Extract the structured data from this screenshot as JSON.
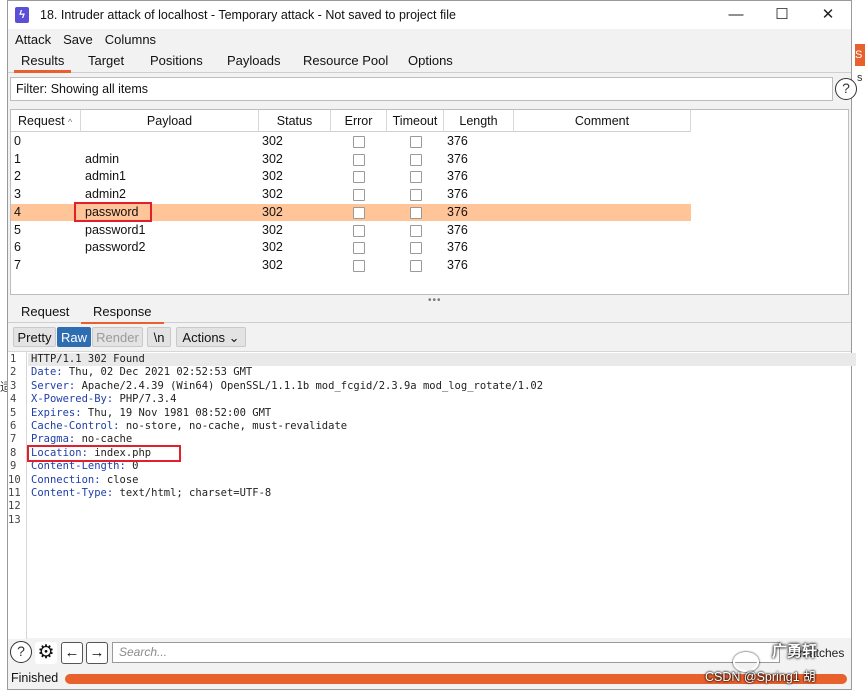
{
  "window": {
    "title": "18. Intruder attack of localhost - Temporary attack - Not saved to project file",
    "app_icon": "burp-bolt-icon",
    "controls": {
      "minimize": "—",
      "maximize": "☐",
      "close": "✕"
    }
  },
  "menu": {
    "items": [
      "Attack",
      "Save",
      "Columns"
    ]
  },
  "tabs": [
    "Results",
    "Target",
    "Positions",
    "Payloads",
    "Resource Pool",
    "Options"
  ],
  "active_tab": "Results",
  "filter": {
    "text": "Filter: Showing all items",
    "help": "?"
  },
  "table": {
    "columns": [
      "Request",
      "Payload",
      "Status",
      "Error",
      "Timeout",
      "Length",
      "Comment"
    ],
    "sort_indicator": "^",
    "rows": [
      {
        "request": "0",
        "payload": "",
        "status": "302",
        "length": "376"
      },
      {
        "request": "1",
        "payload": "admin",
        "status": "302",
        "length": "376"
      },
      {
        "request": "2",
        "payload": "admin1",
        "status": "302",
        "length": "376"
      },
      {
        "request": "3",
        "payload": "admin2",
        "status": "302",
        "length": "376"
      },
      {
        "request": "4",
        "payload": "password",
        "status": "302",
        "length": "376"
      },
      {
        "request": "5",
        "payload": "password1",
        "status": "302",
        "length": "376"
      },
      {
        "request": "6",
        "payload": "password2",
        "status": "302",
        "length": "376"
      },
      {
        "request": "7",
        "payload": "",
        "status": "302",
        "length": "376"
      }
    ],
    "selected_row": 4
  },
  "splitter": "•••",
  "reqres": {
    "tabs": [
      "Request",
      "Response"
    ],
    "active": "Response"
  },
  "viewer": {
    "buttons": {
      "pretty": "Pretty",
      "raw": "Raw",
      "render": "Render",
      "newline": "\\n",
      "actions": "Actions ⌄"
    },
    "line_numbers": [
      "1",
      "2",
      "3",
      "4",
      "5",
      "6",
      "7",
      "8",
      "9",
      "10",
      "11",
      "12",
      "13"
    ],
    "lines": [
      {
        "key": "",
        "value": "HTTP/1.1 302 Found"
      },
      {
        "key": "Date:",
        "value": " Thu, 02 Dec 2021 02:52:53 GMT"
      },
      {
        "key": "Server:",
        "value": " Apache/2.4.39 (Win64) OpenSSL/1.1.1b mod_fcgid/2.3.9a mod_log_rotate/1.02"
      },
      {
        "key": "X-Powered-By:",
        "value": " PHP/7.3.4"
      },
      {
        "key": "Expires:",
        "value": " Thu, 19 Nov 1981 08:52:00 GMT"
      },
      {
        "key": "Cache-Control:",
        "value": " no-store, no-cache, must-revalidate"
      },
      {
        "key": "Pragma:",
        "value": " no-cache"
      },
      {
        "key": "Location:",
        "value": " index.php"
      },
      {
        "key": "Content-Length:",
        "value": " 0"
      },
      {
        "key": "Connection:",
        "value": " close"
      },
      {
        "key": "Content-Type:",
        "value": " text/html; charset=UTF-8"
      },
      {
        "key": "",
        "value": ""
      },
      {
        "key": "",
        "value": ""
      }
    ]
  },
  "bottom": {
    "search_placeholder": "Search...",
    "matches": "0 matches",
    "help": "?",
    "settings": "⚙",
    "prev": "←",
    "next": "→"
  },
  "status": {
    "text": "Finished",
    "progress": 1.0
  },
  "watermark": {
    "brand": "广勇轩",
    "credit": "CSDN @Spring1 胡"
  },
  "background": {
    "tab_letter": "S",
    "side_letter": "s",
    "left_glyph": "适"
  },
  "colors": {
    "accent": "#e8602c",
    "selected_row": "#ffc599",
    "raw_button": "#2f6db3",
    "header_key": "#1f3fa8",
    "annotation": "#e0202a"
  }
}
